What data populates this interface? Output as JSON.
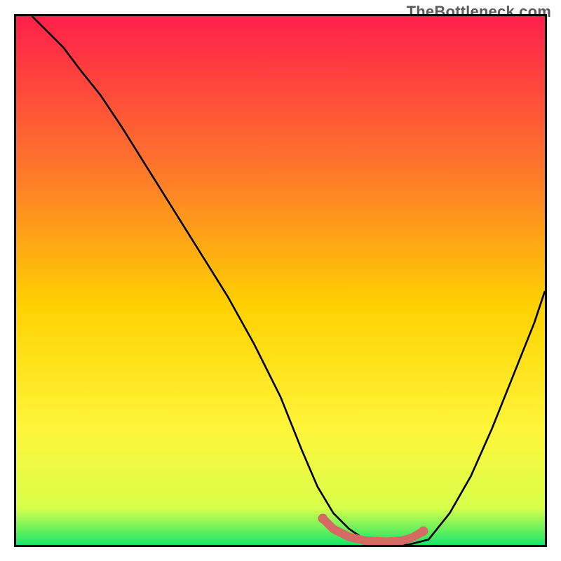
{
  "branding": {
    "watermark": "TheBottleneck.com"
  },
  "colors": {
    "bg_top": "#ff1f4a",
    "bg_mid1": "#ff7a2a",
    "bg_mid2": "#ffd200",
    "bg_mid3": "#fff53a",
    "bg_mid4": "#d8ff4a",
    "bg_bottom": "#19e56a",
    "curve_stroke": "#000000",
    "highlight_stroke": "#d46a63",
    "border": "#000000"
  },
  "chart_data": {
    "type": "line",
    "title": "",
    "xlabel": "",
    "ylabel": "",
    "xlim": [
      0,
      100
    ],
    "ylim": [
      0,
      100
    ],
    "grid": false,
    "legend": false,
    "annotations": [],
    "series": [
      {
        "name": "bottleneck-curve",
        "x": [
          3,
          6,
          9,
          12,
          16,
          20,
          25,
          30,
          35,
          40,
          45,
          50,
          54,
          57,
          60,
          63,
          66,
          70,
          74,
          78,
          82,
          86,
          90,
          94,
          98,
          100
        ],
        "y": [
          100,
          97,
          94,
          90,
          85,
          79,
          71,
          63,
          55,
          47,
          38,
          28,
          18,
          11,
          6,
          3,
          1,
          0,
          0,
          1,
          6,
          13,
          22,
          32,
          42,
          48
        ]
      },
      {
        "name": "optimal-range-highlight",
        "x": [
          58,
          60,
          63,
          66,
          70,
          73,
          75,
          77
        ],
        "y": [
          5,
          3,
          1.5,
          0.8,
          0.6,
          0.8,
          1.4,
          2.6
        ]
      }
    ]
  }
}
